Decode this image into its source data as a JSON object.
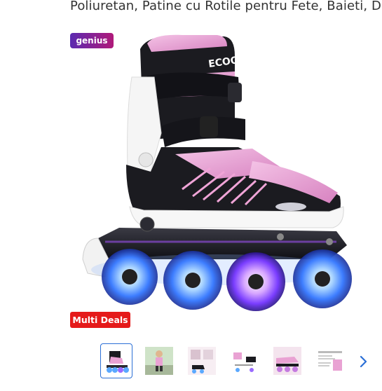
{
  "product": {
    "title_fragment": "Poliuretan, Patine cu Rotile pentru Fete, Baieti, D"
  },
  "badges": {
    "genius": "genius",
    "multi_deals": "Multi Deals"
  },
  "skate_brand_text": "ECOO",
  "gallery": {
    "thumbnail_count": 6,
    "active_index": 0,
    "next_icon": "chevron-right-icon"
  },
  "colors": {
    "multi_deals_red": "#e51a1a",
    "genius_purple": "#5b2bb0",
    "genius_magenta": "#b01a7a",
    "active_thumb_border": "#2b6fd6",
    "skate_pink": "#e9a2d3",
    "wheel_glow": "#5aa8ff"
  }
}
